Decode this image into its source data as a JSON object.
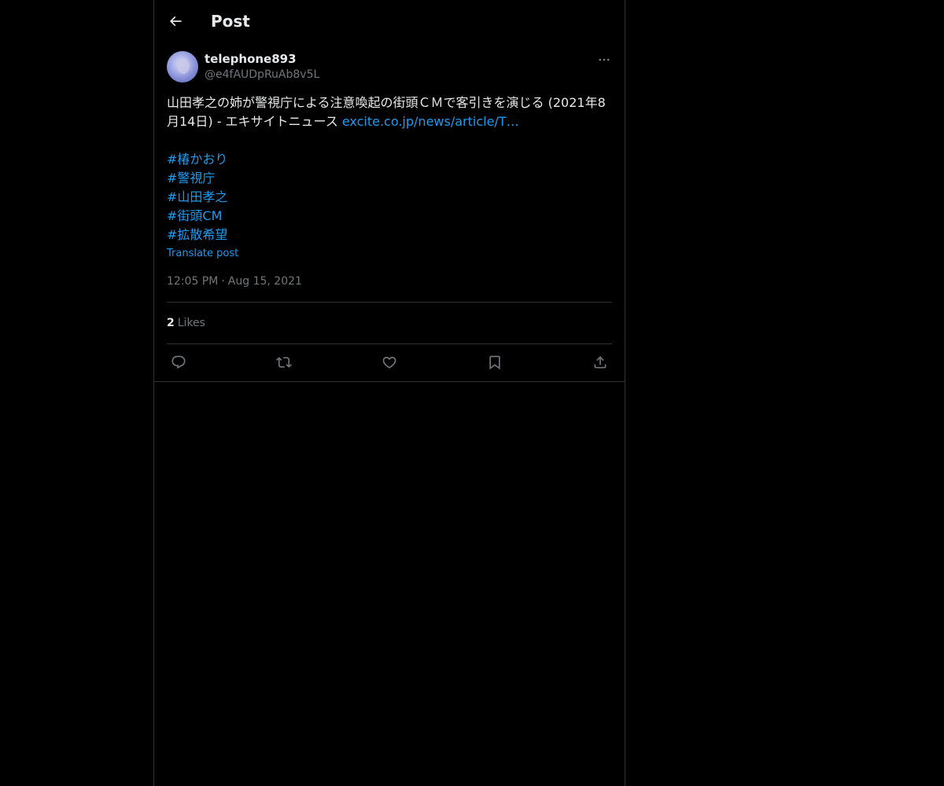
{
  "header": {
    "title": "Post",
    "back_icon": "arrow-left-icon"
  },
  "post": {
    "author": {
      "display_name": "telephone893",
      "handle": "@e4fAUDpRuAb8v5L"
    },
    "text": "山田孝之の姉が警視庁による注意喚起の街頭ＣＭで客引きを演じる (2021年8月14日) - エキサイトニュース ",
    "link_text": "excite.co.jp/news/article/T…",
    "hashtags": [
      "#椿かおり",
      "#警視庁",
      "#山田孝之",
      "#街頭CM",
      "#拡散希望"
    ],
    "translate_label": "Translate post",
    "time": "12:05 PM",
    "separator": "·",
    "date": "Aug 15, 2021",
    "likes_count": "2",
    "likes_label": "Likes"
  },
  "actions": {
    "reply_icon": "reply-icon",
    "repost_icon": "repost-icon",
    "like_icon": "heart-icon",
    "bookmark_icon": "bookmark-icon",
    "share_icon": "share-icon"
  },
  "colors": {
    "background": "#000000",
    "text": "#e7e9ea",
    "muted": "#71767b",
    "accent": "#1d9bf0",
    "border": "#2f3336"
  }
}
